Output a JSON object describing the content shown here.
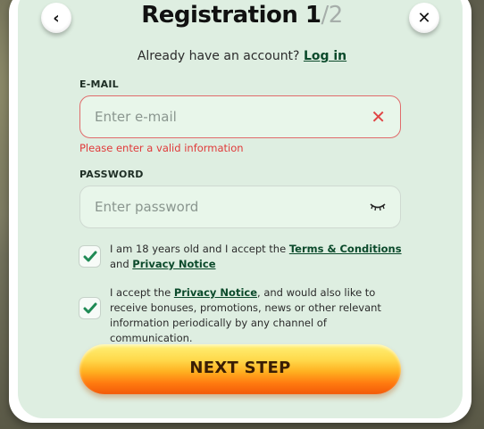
{
  "header": {
    "back_icon": "chevron-left-icon",
    "title_prefix": "Registration 1",
    "title_sep": "/",
    "title_total": "2",
    "close_icon": "close-icon"
  },
  "login_prompt": {
    "text": "Already have an account?",
    "link": "Log in"
  },
  "email": {
    "label": "E-MAIL",
    "placeholder": "Enter e-mail",
    "value": "",
    "error": "Please enter a valid information",
    "clear_icon": "x-icon"
  },
  "password": {
    "label": "PASSWORD",
    "placeholder": "Enter password",
    "value": "",
    "toggle_icon": "eye-closed-icon"
  },
  "consents": [
    {
      "checked": true,
      "text_before": "I am 18 years old and I accept the ",
      "link1": "Terms & Conditions",
      "text_mid": " and ",
      "link2": "Privacy Notice",
      "text_after": ""
    },
    {
      "checked": true,
      "text_before": "I accept the ",
      "link1": "Privacy Notice",
      "text_after": ", and would also like to receive bonuses, promotions, news or other relevant information periodically by any channel of communication."
    }
  ],
  "next_button": {
    "label": "NEXT STEP"
  },
  "colors": {
    "modal_bg": "#deeee1",
    "link": "#0b4a2b",
    "error": "#e03a3a",
    "check": "#1f8a55"
  }
}
